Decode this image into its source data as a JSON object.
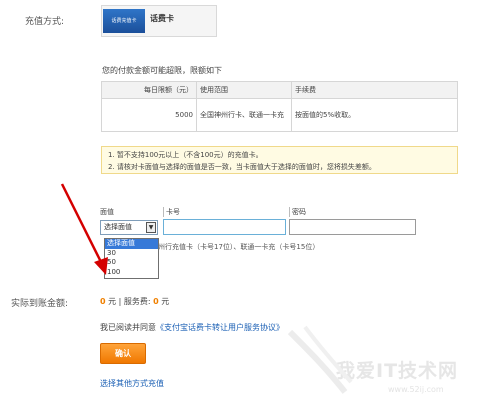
{
  "payment": {
    "label": "充值方式:",
    "card_thumb_text": "话费充值卡",
    "card_name": "话费卡"
  },
  "limits": {
    "note": "您的付款金额可能超限，限额如下",
    "headers": [
      "每日限额（元）",
      "使用范围",
      "手续费"
    ],
    "row": {
      "limit": "5000",
      "scope": "全国神州行卡、联通一卡充",
      "fee": "按面值的5%收取。"
    }
  },
  "notice": {
    "line1": "1. 暂不支持100元以上（不含100元）的充值卡。",
    "line2": "2. 请核对卡面值与选择的面值是否一致，当卡面值大于选择的面值时，您将损失差额。"
  },
  "form": {
    "face_value_label": "面值",
    "card_no_label": "卡号",
    "password_label": "密码",
    "select_value": "选择面值",
    "options": [
      "选择面值",
      "30",
      "50",
      "100"
    ],
    "selected_index": 0,
    "hint": "州行充值卡（卡号17位）、联通一卡充（卡号15位）"
  },
  "amount": {
    "label": "实际到账金额:",
    "received": "0",
    "unit1": "元 | 服务费:",
    "fee": "0",
    "unit2": "元"
  },
  "agreement": {
    "prefix": "我已阅读并同意",
    "link": "《支付宝话费卡转让用户服务协议》"
  },
  "confirm_label": "确认",
  "other_method": "选择其他方式充值",
  "watermark": {
    "text": "我爱IT技术网",
    "url": "www.52ij.com"
  },
  "colors": {
    "accent": "#f07800",
    "link": "#1a5fb4",
    "arrow": "#d40000"
  }
}
